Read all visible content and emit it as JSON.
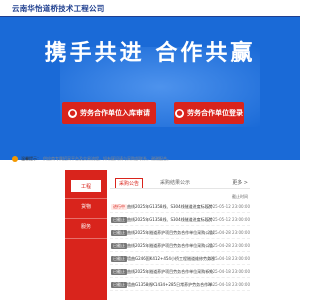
{
  "header": {
    "logo_text": "云南华怡道桥技术工程公司"
  },
  "banner": {
    "slogan": "携手共进 合作共赢",
    "register_label": "劳务合作单位入库审请",
    "login_label": "劳务合作单位登录",
    "register_icon": "person-icon",
    "login_icon": "person-icon",
    "color": "#1a6ad7",
    "button_color": "#d9241c"
  },
  "notice": {
    "label": "温馨提示：",
    "text": "供应商专属招采平台及交易流程，如有疑问请与采购部联系，谢谢配合。"
  },
  "sidebar": {
    "items": [
      {
        "label": "工程"
      },
      {
        "label": "货物"
      },
      {
        "label": "服务"
      }
    ]
  },
  "tabs": {
    "items": [
      {
        "label": "采购公告"
      },
      {
        "label": "采购结果公示"
      }
    ],
    "more_label": "更多 >"
  },
  "list": {
    "col_header": "截止时间",
    "rows": [
      {
        "status": "进行中",
        "title": "曲线2025年G1358线、S304线隧道进度标段劳务分包采购公告",
        "date": "2025-05-12 23:00:00"
      },
      {
        "status": "已截止",
        "title": "曲线2025年G1358线、S304线隧道进度标段劳务分包采购公告",
        "date": "2025-05-12 23:00:00"
      },
      {
        "status": "已截止",
        "title": "曲线2025年隧道养护项目劳务合作单位采购公告(第二批)",
        "date": "2025-04-28 23:00:00"
      },
      {
        "status": "已截止",
        "title": "曲线2025年隧道养护项目劳务合作单位采购公告",
        "date": "2025-04-28 23:00:00"
      },
      {
        "status": "已截止",
        "title": "墙曲G246国K412+454小桥工程隧道维修劳务合作单位采购公告(二次)",
        "date": "2025-04-18 23:00:00"
      },
      {
        "status": "已截止",
        "title": "曲线2025年隧道养护项目劳务合作单位采购补充公告",
        "date": "2025-04-18 23:00:00"
      },
      {
        "status": "已截止",
        "title": "墙曲G1358线K1434+285日常养护劳务合作单位采购公告",
        "date": "2025-04-18 23:00:00"
      }
    ]
  }
}
